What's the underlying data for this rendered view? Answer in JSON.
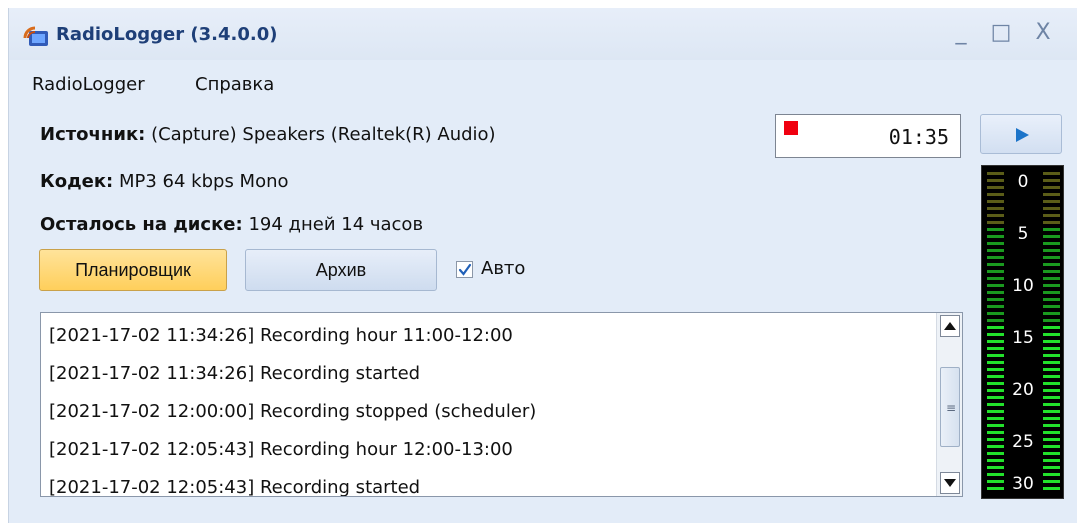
{
  "window": {
    "title": "RadioLogger (3.4.0.0)",
    "controls": {
      "minimize": "_",
      "maximize": "□",
      "close": "X"
    }
  },
  "menu": {
    "items": [
      "RadioLogger",
      "Справка"
    ]
  },
  "info": {
    "source_label": "Источник:",
    "source_value": "(Capture) Speakers (Realtek(R) Audio)",
    "codec_label": "Кодек:",
    "codec_value": "MP3 64 kbps Mono",
    "disk_label": "Осталось на диске:",
    "disk_value": "194 дней 14 часов"
  },
  "recorder": {
    "time": "01:35",
    "recording_indicator_color": "#f00010"
  },
  "buttons": {
    "scheduler": "Планировщик",
    "archive": "Архив",
    "auto_label": "Авто",
    "auto_checked": true
  },
  "log": {
    "lines": [
      "[2021-17-02 11:34:26] Recording hour 11:00-12:00",
      "[2021-17-02 11:34:26] Recording started",
      "[2021-17-02 12:00:00] Recording stopped (scheduler)",
      "[2021-17-02 12:05:43] Recording hour 12:00-13:00",
      "[2021-17-02 12:05:43] Recording started"
    ]
  },
  "vu_meter": {
    "scale_labels": [
      "0",
      "5",
      "10",
      "15",
      "20",
      "25",
      "30"
    ],
    "colors": {
      "bright": "#22e12b",
      "mid": "#1a9a1f",
      "dim": "#5b5d18"
    }
  },
  "icons": {
    "app": "radio-logger-icon",
    "play": "play-icon",
    "checkbox": "check-icon",
    "scroll_up": "chevron-up-icon",
    "scroll_down": "chevron-down-icon"
  }
}
